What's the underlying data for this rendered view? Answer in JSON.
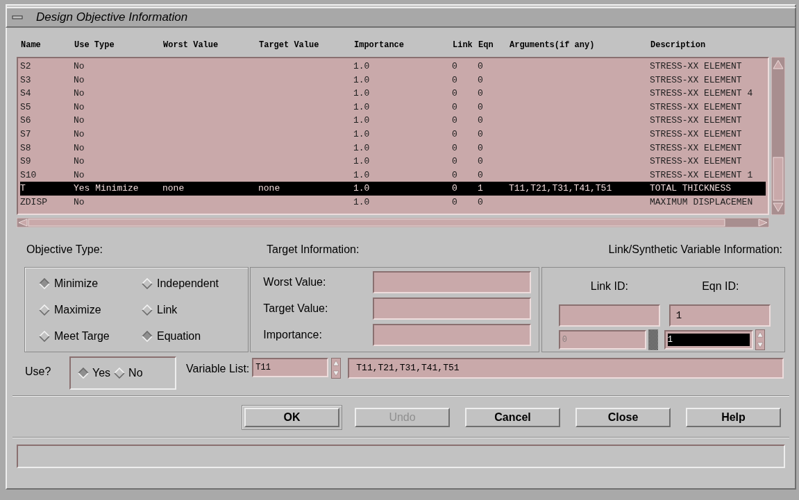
{
  "window": {
    "title": "Design Objective Information"
  },
  "table": {
    "columns": [
      "Name",
      "Use Type",
      "Worst Value",
      "Target Value",
      "Importance",
      "Link",
      "Eqn",
      "Arguments(if any)",
      "Description"
    ],
    "rows": [
      {
        "cells": [
          "S2",
          "No",
          "",
          "",
          "1.0",
          "0",
          "0",
          "",
          "STRESS-XX ELEMENT"
        ],
        "selected": false
      },
      {
        "cells": [
          "S3",
          "No",
          "",
          "",
          "1.0",
          "0",
          "0",
          "",
          "STRESS-XX ELEMENT"
        ],
        "selected": false
      },
      {
        "cells": [
          "S4",
          "No",
          "",
          "",
          "1.0",
          "0",
          "0",
          "",
          "STRESS-XX ELEMENT 4"
        ],
        "selected": false
      },
      {
        "cells": [
          "S5",
          "No",
          "",
          "",
          "1.0",
          "0",
          "0",
          "",
          "STRESS-XX ELEMENT"
        ],
        "selected": false
      },
      {
        "cells": [
          "S6",
          "No",
          "",
          "",
          "1.0",
          "0",
          "0",
          "",
          "STRESS-XX ELEMENT"
        ],
        "selected": false
      },
      {
        "cells": [
          "S7",
          "No",
          "",
          "",
          "1.0",
          "0",
          "0",
          "",
          "STRESS-XX ELEMENT"
        ],
        "selected": false
      },
      {
        "cells": [
          "S8",
          "No",
          "",
          "",
          "1.0",
          "0",
          "0",
          "",
          "STRESS-XX ELEMENT"
        ],
        "selected": false
      },
      {
        "cells": [
          "S9",
          "No",
          "",
          "",
          "1.0",
          "0",
          "0",
          "",
          "STRESS-XX ELEMENT"
        ],
        "selected": false
      },
      {
        "cells": [
          "S10",
          "No",
          "",
          "",
          "1.0",
          "0",
          "0",
          "",
          "STRESS-XX ELEMENT 1"
        ],
        "selected": false
      },
      {
        "cells": [
          "T",
          "Yes Minimize",
          "none",
          "none",
          "1.0",
          "0",
          "1",
          "T11,T21,T31,T41,T51",
          "TOTAL THICKNESS"
        ],
        "selected": true
      },
      {
        "cells": [
          "ZDISP",
          "No",
          "",
          "",
          "1.0",
          "0",
          "0",
          "",
          "MAXIMUM DISPLACEMEN"
        ],
        "selected": false
      }
    ]
  },
  "objective_type": {
    "label": "Objective Type:",
    "groups": [
      [
        {
          "label": "Minimize",
          "selected": true
        },
        {
          "label": "Maximize",
          "selected": false
        },
        {
          "label": "Meet Targe",
          "selected": false
        }
      ],
      [
        {
          "label": "Independent",
          "selected": false
        },
        {
          "label": "Link",
          "selected": false
        },
        {
          "label": "Equation",
          "selected": true
        }
      ]
    ]
  },
  "target_information": {
    "label": "Target Information:",
    "fields": [
      {
        "label": "Worst Value:"
      },
      {
        "label": "Target Value:"
      },
      {
        "label": "Importance:"
      }
    ]
  },
  "link_information": {
    "label": "Link/Synthetic Variable Information:",
    "link_id": {
      "label": "Link ID:",
      "spin_value": "0",
      "spin_disabled": true
    },
    "eqn_id": {
      "label": "Eqn ID:",
      "value": "1",
      "spin_value": "1",
      "spin_disabled": false
    }
  },
  "use": {
    "label": "Use?",
    "options": [
      {
        "label": "Yes",
        "selected": true
      },
      {
        "label": "No",
        "selected": false
      }
    ]
  },
  "variable_list": {
    "label": "Variable List:",
    "spin_value": "T11",
    "value": "T11,T21,T31,T41,T51"
  },
  "buttons": [
    {
      "label": "OK",
      "default": true,
      "disabled": false
    },
    {
      "label": "Undo",
      "default": false,
      "disabled": true
    },
    {
      "label": "Cancel",
      "default": false,
      "disabled": false
    },
    {
      "label": "Close",
      "default": false,
      "disabled": false
    },
    {
      "label": "Help",
      "default": false,
      "disabled": false
    }
  ]
}
